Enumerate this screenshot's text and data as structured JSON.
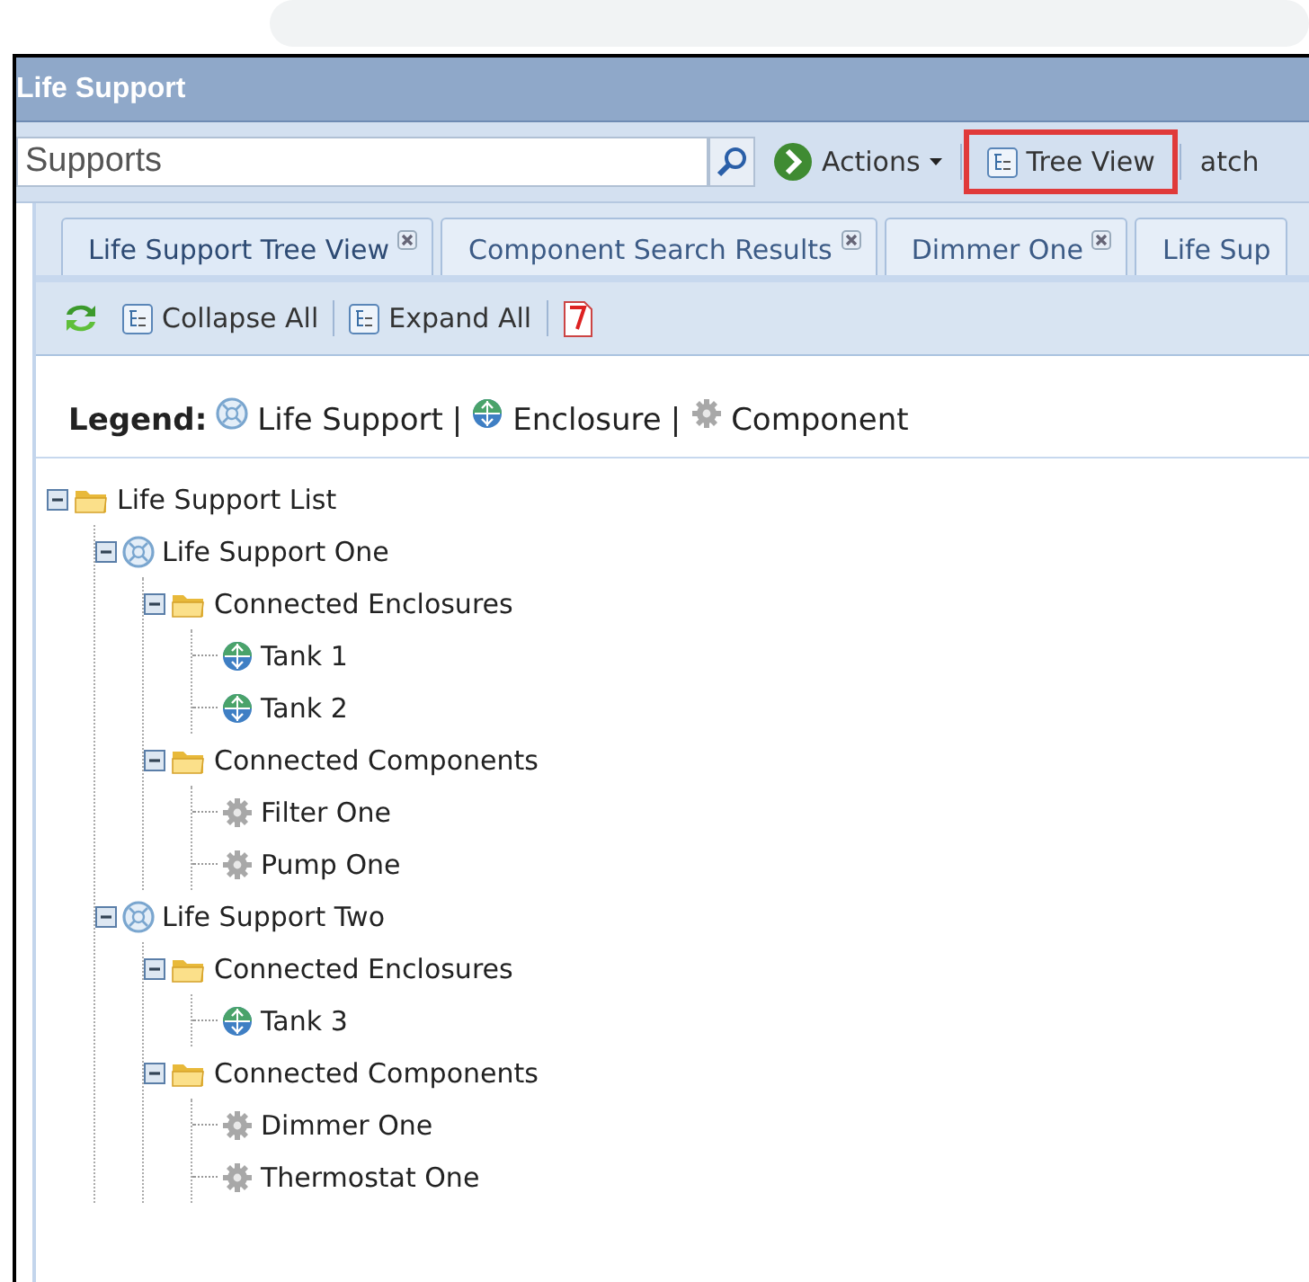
{
  "window": {
    "title": "Life Support"
  },
  "toolbar": {
    "search": {
      "value": "Supports"
    },
    "buttons": [
      {
        "kind": "actions",
        "label": "Actions",
        "highlighted": false
      },
      {
        "kind": "tree",
        "label": "Tree View",
        "highlighted": true
      },
      {
        "kind": "plain",
        "label": "atch",
        "highlighted": false
      }
    ]
  },
  "tabs": [
    {
      "label": "Life Support Tree View",
      "selected": true,
      "closable": true
    },
    {
      "label": "Component Search Results",
      "selected": false,
      "closable": true
    },
    {
      "label": "Dimmer One",
      "selected": false,
      "closable": true
    },
    {
      "label": "Life Sup",
      "selected": false,
      "closable": false
    }
  ],
  "tree_toolbar": [
    {
      "kind": "refresh"
    },
    {
      "kind": "collapse",
      "label": "Collapse All"
    },
    {
      "kind": "expand",
      "label": "Expand All"
    },
    {
      "kind": "pdf"
    }
  ],
  "legend": {
    "title": "Legend:",
    "items": [
      {
        "kind": "life_support",
        "label": "Life Support"
      },
      {
        "kind": "enclosure",
        "label": "Enclosure"
      },
      {
        "kind": "component",
        "label": "Component"
      }
    ],
    "separator": "|"
  },
  "tree": [
    {
      "kind": "folder",
      "label": "Life Support List",
      "expanded": true,
      "children": [
        {
          "kind": "life_support",
          "label": "Life Support One",
          "expanded": true,
          "children": [
            {
              "kind": "folder",
              "label": "Connected Enclosures",
              "expanded": true,
              "children": [
                {
                  "kind": "enclosure",
                  "label": "Tank 1"
                },
                {
                  "kind": "enclosure",
                  "label": "Tank 2"
                }
              ]
            },
            {
              "kind": "folder",
              "label": "Connected Components",
              "expanded": true,
              "children": [
                {
                  "kind": "component",
                  "label": "Filter One"
                },
                {
                  "kind": "component",
                  "label": "Pump One"
                }
              ]
            }
          ]
        },
        {
          "kind": "life_support",
          "label": "Life Support Two",
          "expanded": true,
          "children": [
            {
              "kind": "folder",
              "label": "Connected Enclosures",
              "expanded": true,
              "children": [
                {
                  "kind": "enclosure",
                  "label": "Tank 3"
                }
              ]
            },
            {
              "kind": "folder",
              "label": "Connected Components",
              "expanded": true,
              "children": [
                {
                  "kind": "component",
                  "label": "Dimmer One"
                },
                {
                  "kind": "component",
                  "label": "Thermostat One"
                }
              ]
            }
          ]
        }
      ]
    }
  ]
}
